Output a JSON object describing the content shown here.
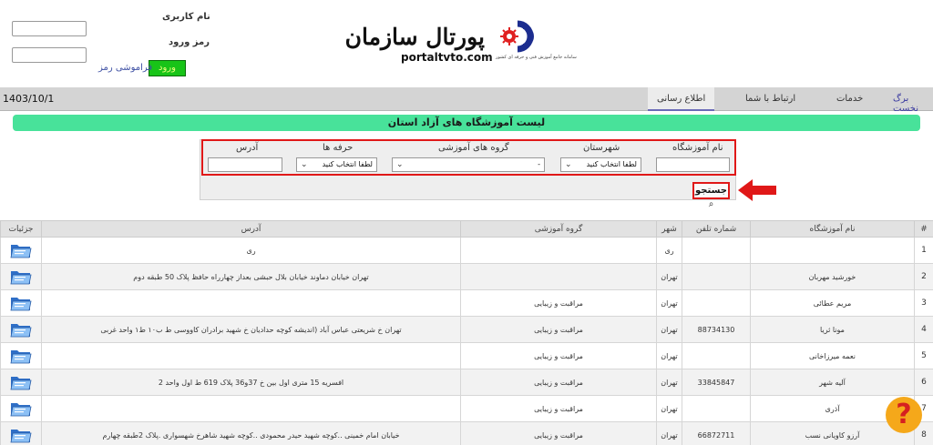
{
  "login": {
    "username_label": "نام کاربری",
    "password_label": "رمز ورود",
    "username_value": "",
    "password_value": "",
    "login_button": "ورود",
    "forgot_link": "فراموشی رمز"
  },
  "logo": {
    "title": "پورتال سازمان",
    "domain": "portaltvto.com",
    "subtitle": "سامانه جامع آموزش فنی و حرفه ای کشور"
  },
  "nav": {
    "date": "1403/10/1",
    "items": [
      {
        "label": "برگ نخست"
      },
      {
        "label": "خدمات"
      },
      {
        "label": "ارتباط با شما"
      },
      {
        "label": "اطلاع رسانی"
      }
    ]
  },
  "page_title": "لیست آموزشگاه های آزاد استان",
  "filters": {
    "institute_label": "نام آموزشگاه",
    "institute_value": "",
    "city_label": "شهرستان",
    "city_value": "لطفا انتخاب کنید",
    "group_label": "گروه های آموزشی",
    "group_value": "-",
    "trade_label": "حرفه ها",
    "trade_value": "لطفا انتخاب کنید",
    "address_label": "آدرس",
    "address_value": "",
    "search_button": "جستجو"
  },
  "table": {
    "headers": {
      "index": "#",
      "name": "نام آموزشگاه",
      "phone": "شماره تلفن",
      "city": "شهر",
      "group": "گروه آموزشی",
      "address": "آدرس",
      "details": "جزئیات"
    },
    "rows": [
      {
        "index": "1",
        "name": "",
        "phone": "",
        "city": "ری",
        "group": "",
        "address": "ری"
      },
      {
        "index": "2",
        "name": "خورشید مهربان",
        "phone": "",
        "city": "تهران",
        "group": "",
        "address": "تهران خیابان دماوند خیابان بلال حبشی بعداز چهارراه حافظ پلاک 50 طبقه دوم"
      },
      {
        "index": "3",
        "name": "مریم عطائی",
        "phone": "",
        "city": "تهران",
        "group": "مراقبت و زیبایی",
        "address": ""
      },
      {
        "index": "4",
        "name": "مونا ثریا",
        "phone": "88734130",
        "city": "تهران",
        "group": "مراقبت و زیبایی",
        "address": "تهران خ شریعتی عباس آباد (اندیشه کوچه حدادیان خ شهید برادران کاووسی ط ب۱۰ ط۱ واحد غربی"
      },
      {
        "index": "5",
        "name": "نعمه میرزاخانی",
        "phone": "",
        "city": "تهران",
        "group": "مراقبت و زیبایی",
        "address": ""
      },
      {
        "index": "6",
        "name": "آلیه شهر",
        "phone": "33845847",
        "city": "تهران",
        "group": "مراقبت و زیبایی",
        "address": "افسریه 15 متری اول بین خ 37و36 پلاک 619 ط اول واحد 2"
      },
      {
        "index": "7",
        "name": "آذری",
        "phone": "",
        "city": "تهران",
        "group": "مراقبت و زیبایی",
        "address": ""
      },
      {
        "index": "8",
        "name": "آرزو کاویانی نسب",
        "phone": "66872711",
        "city": "تهران",
        "group": "مراقبت و زیبایی",
        "address": "خیابان امام خمینی ..کوچه شهید حیدر محمودی ..کوچه شهید شاهرخ شهسواری .پلاک 2طبقه چهارم"
      }
    ]
  },
  "help": {
    "symbol": "?"
  },
  "colors": {
    "title_bar": "#48e29a",
    "login_button": "#18c418",
    "highlight": "#e01818",
    "help_bubble": "#f5a81a"
  }
}
